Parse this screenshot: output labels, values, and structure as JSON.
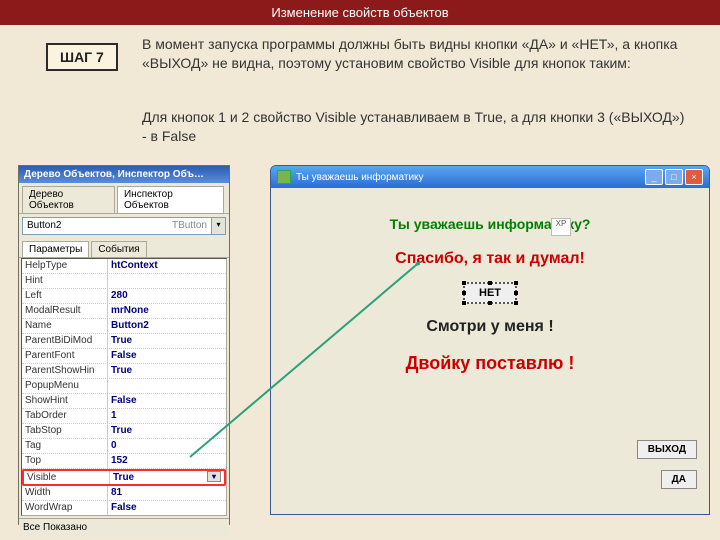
{
  "header": {
    "title": "Изменение свойств объектов"
  },
  "step": {
    "label": "ШАГ 7"
  },
  "paragraphs": {
    "p1": "В момент запуска программы должны быть видны кнопки «ДА» и «НЕТ», а кнопка «ВЫХОД» не видна, поэтому установим свойство Visible для кнопок таким:",
    "p2": "Для кнопок 1 и 2 свойство Visible устанавливаем в True, а для кнопки 3 («ВЫХОД») - в False"
  },
  "inspector": {
    "title": "Дерево Объектов, Инспектор Объ…",
    "tree_tab": "Дерево Объектов",
    "insp_tab": "Инспектор Объектов",
    "selected_object": "Button2",
    "selected_type": "TButton",
    "tab_params": "Параметры",
    "tab_events": "События",
    "status": "Все Показано",
    "props": [
      {
        "name": "HelpType",
        "value": "htContext"
      },
      {
        "name": "Hint",
        "value": ""
      },
      {
        "name": "Left",
        "value": "280"
      },
      {
        "name": "ModalResult",
        "value": "mrNone"
      },
      {
        "name": "Name",
        "value": "Button2"
      },
      {
        "name": "ParentBiDiMod",
        "value": "True"
      },
      {
        "name": "ParentFont",
        "value": "False"
      },
      {
        "name": "ParentShowHin",
        "value": "True"
      },
      {
        "name": "PopupMenu",
        "value": ""
      },
      {
        "name": "ShowHint",
        "value": "False"
      },
      {
        "name": "TabOrder",
        "value": "1"
      },
      {
        "name": "TabStop",
        "value": "True"
      },
      {
        "name": "Tag",
        "value": "0"
      },
      {
        "name": "Top",
        "value": "152"
      },
      {
        "name": "Visible",
        "value": "True"
      },
      {
        "name": "Width",
        "value": "81"
      },
      {
        "name": "WordWrap",
        "value": "False"
      }
    ],
    "highlighted_row": 14
  },
  "app": {
    "title": "Ты уважаешь информатику",
    "question": "Ты уважаешь информатику?",
    "thanks": "Спасибо, я так и думал!",
    "no_btn": "НЕТ",
    "look": "Смотри у меня !",
    "fail": "Двойку поставлю !",
    "exit_btn": "ВЫХОД",
    "yes_btn": "ДА",
    "xp_badge": "XP"
  }
}
